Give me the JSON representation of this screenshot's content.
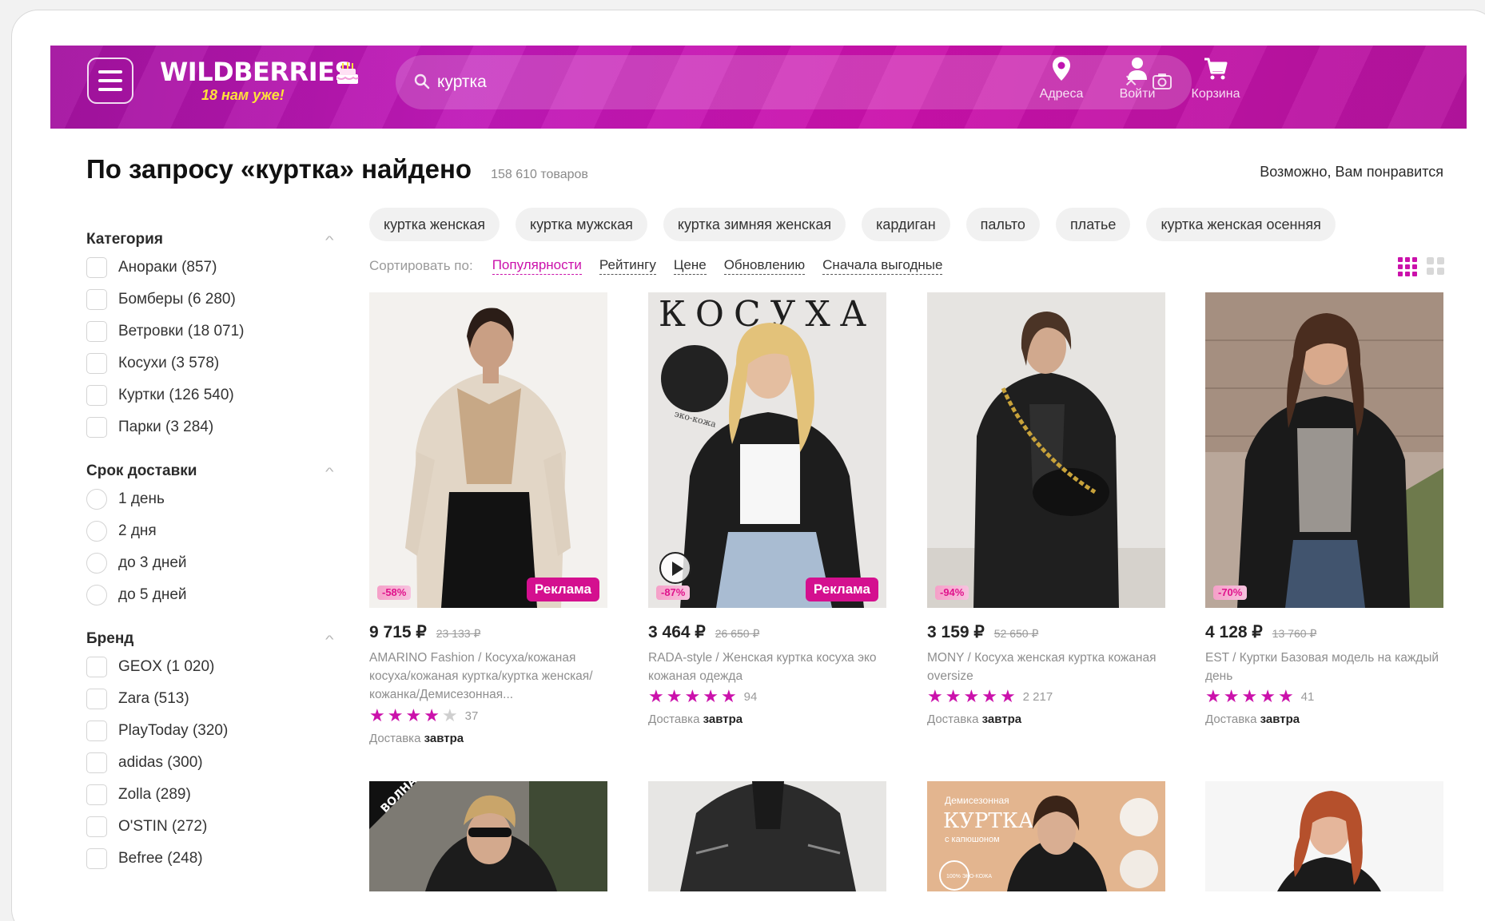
{
  "header": {
    "logo": "WILDBERRIES",
    "logo_sub": "18 нам уже!",
    "search_value": "куртка",
    "nav": [
      "Адреса",
      "Войти",
      "Корзина"
    ]
  },
  "colors": {
    "brand": "#cb11ab",
    "accent_yellow": "#ffe13a",
    "ad_badge": "#d4108f"
  },
  "results": {
    "title": "По запросу «куртка» найдено",
    "count": "158 610 товаров",
    "maybe": "Возможно, Вам понравится"
  },
  "filters": [
    {
      "title": "Категория",
      "type": "checkbox",
      "items": [
        "Анораки (857)",
        "Бомберы (6 280)",
        "Ветровки (18 071)",
        "Косухи (3 578)",
        "Куртки (126 540)",
        "Парки (3 284)"
      ]
    },
    {
      "title": "Срок доставки",
      "type": "radio",
      "items": [
        "1 день",
        "2 дня",
        "до 3 дней",
        "до 5 дней"
      ]
    },
    {
      "title": "Бренд",
      "type": "checkbox",
      "items": [
        "GEOX (1 020)",
        "Zara (513)",
        "PlayToday (320)",
        "adidas (300)",
        "Zolla (289)",
        "O'STIN (272)",
        "Befree (248)"
      ]
    }
  ],
  "chips": [
    "куртка женская",
    "куртка мужская",
    "куртка зимняя женская",
    "кардиган",
    "пальто",
    "платье",
    "куртка женская осенняя"
  ],
  "sort": {
    "label": "Сортировать по:",
    "options": [
      "Популярности",
      "Рейтингу",
      "Цене",
      "Обновлению",
      "Сначала выгодные"
    ],
    "active": "Популярности"
  },
  "products": [
    {
      "price": "9 715 ₽",
      "old_price": "23 133 ₽",
      "discount": "-58%",
      "ad": "Реклама",
      "brand": "AMARINO Fashion",
      "name": "Косуха/кожаная косуха/кожаная куртка/куртка женская/кожанка/Демисезонная...",
      "rating": 4,
      "reviews": "37",
      "delivery_label": "Доставка",
      "delivery_when": "завтра"
    },
    {
      "price": "3 464 ₽",
      "old_price": "26 650 ₽",
      "discount": "-87%",
      "ad": "Реклама",
      "image_text": "КОСУХА",
      "image_sub": "эко-кожа",
      "brand": "RADA-style",
      "name": "Женская куртка косуха эко кожаная одежда",
      "rating": 5,
      "reviews": "94",
      "delivery_label": "Доставка",
      "delivery_when": "завтра"
    },
    {
      "price": "3 159 ₽",
      "old_price": "52 650 ₽",
      "discount": "-94%",
      "brand": "MONY",
      "name": "Косуха женская куртка кожаная oversize",
      "rating": 5,
      "reviews": "2 217",
      "delivery_label": "Доставка",
      "delivery_when": "завтра"
    },
    {
      "price": "4 128 ₽",
      "old_price": "13 760 ₽",
      "discount": "-70%",
      "brand": "EST",
      "name": "Куртки Базовая модель на каждый день",
      "rating": 5,
      "reviews": "41",
      "delivery_label": "Доставка",
      "delivery_when": "завтра"
    }
  ],
  "products_row2": [
    {
      "badge": "ВОЛНА"
    },
    {},
    {
      "title_small": "Демисезонная",
      "title_big": "КУРТКА",
      "title_sub": "с капюшоном",
      "stamp": "100% ЭКО-КОЖА"
    },
    {}
  ]
}
